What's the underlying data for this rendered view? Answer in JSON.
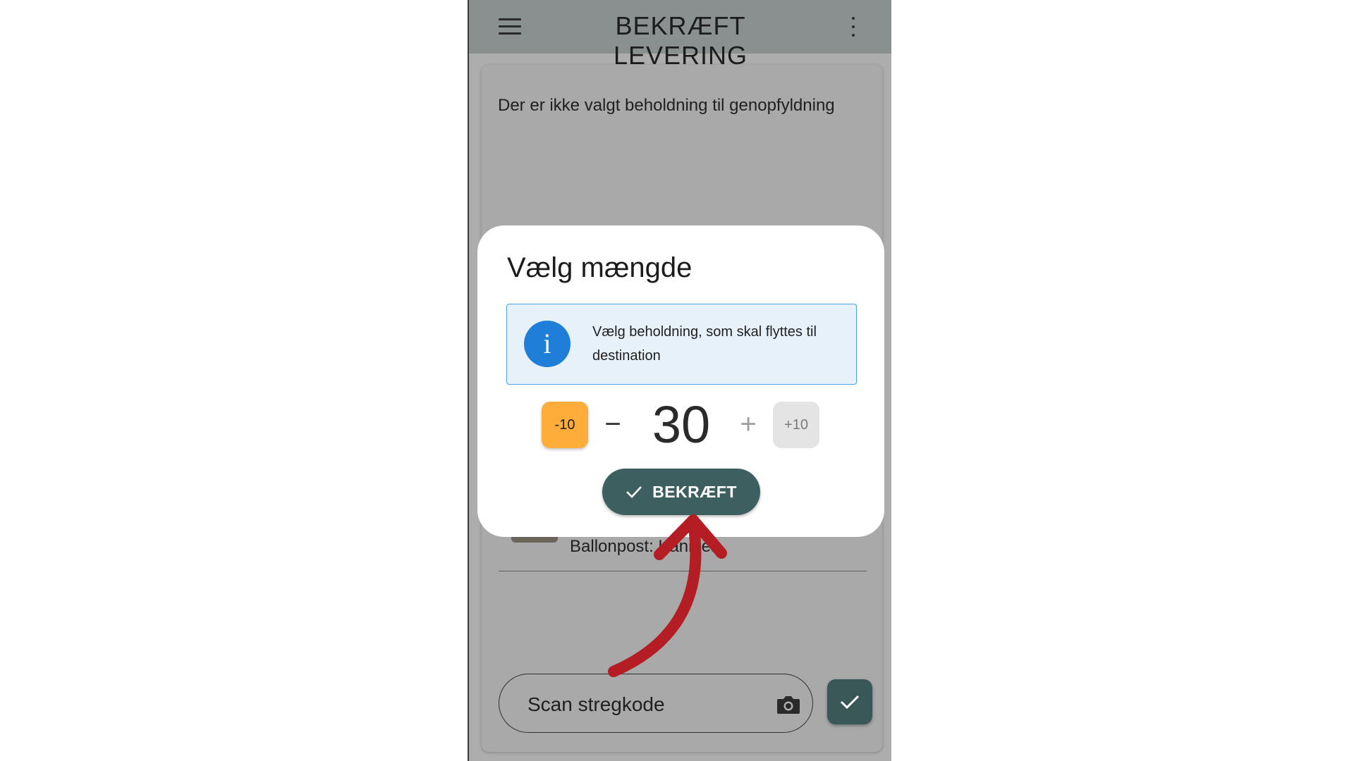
{
  "appbar": {
    "title": "BEKRÆFT LEVERING",
    "menu_icon": "hamburger-menu-icon",
    "more_icon": "kebab-more-icon"
  },
  "card": {
    "empty_message": "Der er ikke valgt beholdning til genopfyldning",
    "list_item_name": "Ballonpost: Kaninen"
  },
  "scan": {
    "placeholder": "Scan stregkode",
    "camera_icon": "camera-icon",
    "submit_icon": "check-icon"
  },
  "dialog": {
    "title": "Vælg mængde",
    "info_icon": "info-icon",
    "info_glyph": "i",
    "info_text": "Vælg beholdning, som skal flyttes til destination",
    "decrement_ten": "-10",
    "decrement_one": "−",
    "quantity": "30",
    "increment_one": "+",
    "increment_ten": "+10",
    "confirm_label": "BEKRÆFT",
    "confirm_icon": "check-icon"
  },
  "annotation": {
    "arrow_color": "#b51d24"
  },
  "colors": {
    "appbar": "#8a8f8f",
    "overlay": "#adadad",
    "primary": "#3d5f5f",
    "decrement_accent": "#ffad3a",
    "info_blue": "#1f7ed8"
  }
}
